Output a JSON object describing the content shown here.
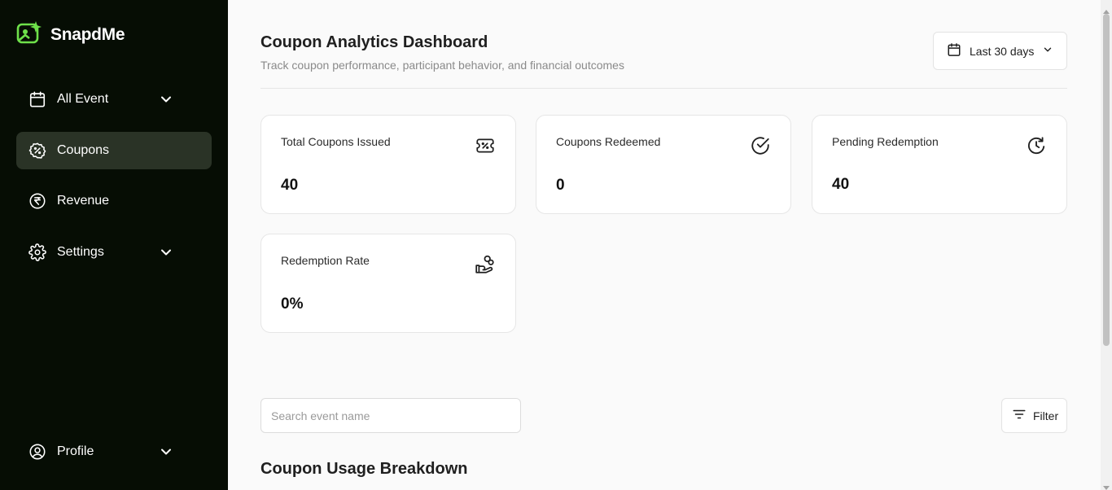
{
  "brand": {
    "name": "SnapdMe",
    "accent": "#6ee04a"
  },
  "sidebar": {
    "items": [
      {
        "label": "All Event",
        "icon": "calendar-icon",
        "has_chevron": true
      },
      {
        "label": "Coupons",
        "icon": "discount-badge-icon",
        "active": true
      },
      {
        "label": "Revenue",
        "icon": "rupee-icon"
      },
      {
        "label": "Settings",
        "icon": "gear-icon",
        "has_chevron": true
      }
    ],
    "profile": {
      "label": "Profile",
      "icon": "user-circle-icon"
    }
  },
  "header": {
    "title": "Coupon Analytics Dashboard",
    "subtitle": "Track coupon performance, participant behavior, and financial outcomes",
    "date_range": "Last 30 days"
  },
  "stats": [
    {
      "label": "Total Coupons Issued",
      "value": "40",
      "icon": "ticket-percent-icon"
    },
    {
      "label": "Coupons Redeemed",
      "value": "0",
      "icon": "check-circle-icon"
    },
    {
      "label": "Pending Redemption",
      "value": "40",
      "icon": "clock-refresh-icon"
    },
    {
      "label": "Redemption Rate",
      "value": "0%",
      "icon": "hand-coins-icon"
    }
  ],
  "search": {
    "placeholder": "Search event name",
    "value": ""
  },
  "filter": {
    "label": "Filter"
  },
  "section": {
    "title": "Coupon Usage Breakdown"
  }
}
